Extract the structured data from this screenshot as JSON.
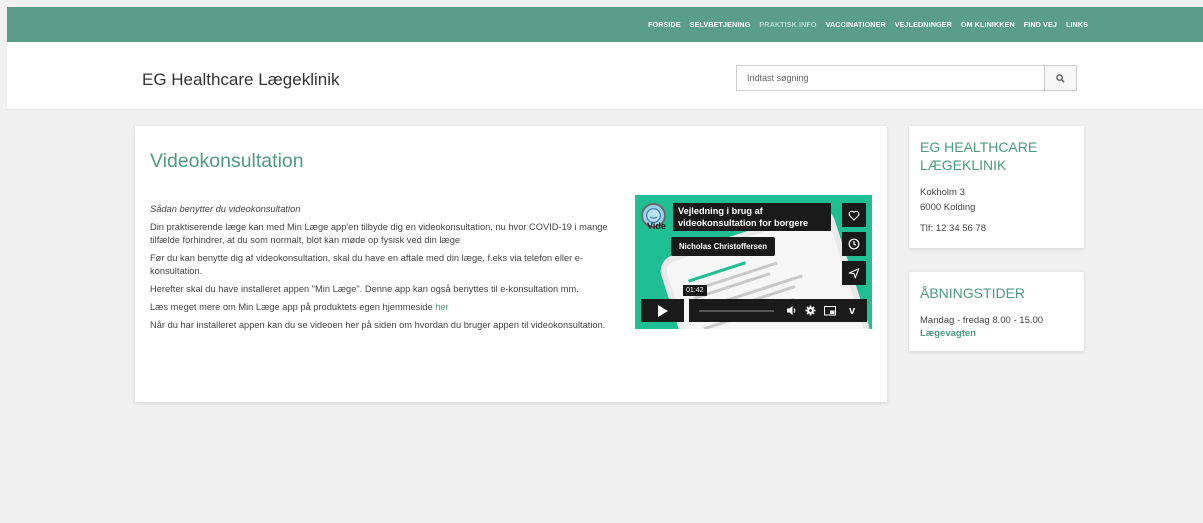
{
  "topnav": {
    "items": [
      {
        "label": "FORSIDE"
      },
      {
        "label": "SELVBETJENING"
      },
      {
        "label": "PRAKTISK INFO"
      },
      {
        "label": "VACCINATIONER"
      },
      {
        "label": "VEJLEDNINGER"
      },
      {
        "label": "OM KLINIKKEN"
      },
      {
        "label": "FIND VEJ"
      },
      {
        "label": "LINKS"
      }
    ],
    "active_index": 2
  },
  "header": {
    "brand": "EG Healthcare Lægeklinik",
    "search": {
      "placeholder": "Indtast søgning",
      "value": "",
      "button_icon": "search-icon"
    }
  },
  "main": {
    "title": "Videokonsultation",
    "intro": "Sådan benytter du videokonsultation",
    "p1": "Din praktiserende læge kan med Min Læge app'en tilbyde dig en videokonsultation, nu hvor COVID-19 i mange tilfælde forhindrer, at du som normalt, blot kan møde op fysisk ved din læge",
    "p2": "Før du kan benytte dig af videokonsultation, skal du have en aftale med din læge, f.eks via telefon eller e-konsultation.",
    "p3": "Herefter skal du have installeret appen \"Min Læge\". Denne app kan også benyttes til e-konsultation mm.",
    "p4_prefix": "Læs meget mere om Min Læge app på produktets egen hjemmeside ",
    "p4_link": "her",
    "p5": "Når du har installeret appen kan du se videoen her på siden om hvordan du bruger appen til videokonsultation.",
    "video": {
      "title": "Vejledning i brug af videokonsultation for borgere",
      "author": "Nicholas Christoffersen",
      "channel_label": "Vide",
      "time": "01:42",
      "icons": [
        "heart-icon",
        "clock-icon",
        "share-icon",
        "play-icon",
        "volume-icon",
        "settings-icon",
        "pip-icon",
        "vimeo-icon"
      ],
      "vimeo_glyph": "v"
    }
  },
  "sidebar": {
    "clinic": {
      "title": "EG HEALTHCARE LÆGEKLINIK",
      "address1": "Kokholm 3",
      "address2": "6000 Kolding",
      "phone": "Tlf: 12 34 56 78"
    },
    "hours": {
      "title": "ÅBNINGSTIDER",
      "line": "Mandag - fredag 8.00 - 15.00",
      "link": "Lægevagten"
    }
  },
  "colors": {
    "nav_bg": "#5a9e8a",
    "accent": "#4e9a83",
    "video_bg": "#1fbf93"
  }
}
